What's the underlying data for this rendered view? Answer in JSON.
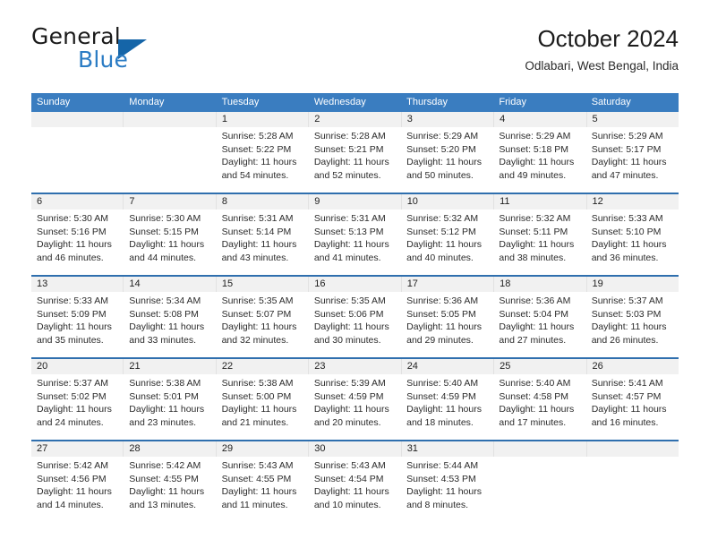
{
  "logo": {
    "word_top": "General",
    "word_bottom": "Blue",
    "triangle_color": "#1565a8",
    "blue_text_color": "#2b7cc4"
  },
  "header": {
    "title": "October 2024",
    "subtitle": "Odlabari, West Bengal, India"
  },
  "theme": {
    "header_blue": "#3a7dc0",
    "rule_blue": "#2f6fae",
    "number_band": "#f1f1f1"
  },
  "weekdays": [
    "Sunday",
    "Monday",
    "Tuesday",
    "Wednesday",
    "Thursday",
    "Friday",
    "Saturday"
  ],
  "labels": {
    "sunrise_prefix": "Sunrise:",
    "sunset_prefix": "Sunset:",
    "daylight_prefix": "Daylight:"
  },
  "weeks": [
    {
      "days": [
        {
          "num": "",
          "sunrise": "",
          "sunset": "",
          "daylight": ""
        },
        {
          "num": "",
          "sunrise": "",
          "sunset": "",
          "daylight": ""
        },
        {
          "num": "1",
          "sunrise": "Sunrise: 5:28 AM",
          "sunset": "Sunset: 5:22 PM",
          "daylight": "Daylight: 11 hours and 54 minutes."
        },
        {
          "num": "2",
          "sunrise": "Sunrise: 5:28 AM",
          "sunset": "Sunset: 5:21 PM",
          "daylight": "Daylight: 11 hours and 52 minutes."
        },
        {
          "num": "3",
          "sunrise": "Sunrise: 5:29 AM",
          "sunset": "Sunset: 5:20 PM",
          "daylight": "Daylight: 11 hours and 50 minutes."
        },
        {
          "num": "4",
          "sunrise": "Sunrise: 5:29 AM",
          "sunset": "Sunset: 5:18 PM",
          "daylight": "Daylight: 11 hours and 49 minutes."
        },
        {
          "num": "5",
          "sunrise": "Sunrise: 5:29 AM",
          "sunset": "Sunset: 5:17 PM",
          "daylight": "Daylight: 11 hours and 47 minutes."
        }
      ]
    },
    {
      "days": [
        {
          "num": "6",
          "sunrise": "Sunrise: 5:30 AM",
          "sunset": "Sunset: 5:16 PM",
          "daylight": "Daylight: 11 hours and 46 minutes."
        },
        {
          "num": "7",
          "sunrise": "Sunrise: 5:30 AM",
          "sunset": "Sunset: 5:15 PM",
          "daylight": "Daylight: 11 hours and 44 minutes."
        },
        {
          "num": "8",
          "sunrise": "Sunrise: 5:31 AM",
          "sunset": "Sunset: 5:14 PM",
          "daylight": "Daylight: 11 hours and 43 minutes."
        },
        {
          "num": "9",
          "sunrise": "Sunrise: 5:31 AM",
          "sunset": "Sunset: 5:13 PM",
          "daylight": "Daylight: 11 hours and 41 minutes."
        },
        {
          "num": "10",
          "sunrise": "Sunrise: 5:32 AM",
          "sunset": "Sunset: 5:12 PM",
          "daylight": "Daylight: 11 hours and 40 minutes."
        },
        {
          "num": "11",
          "sunrise": "Sunrise: 5:32 AM",
          "sunset": "Sunset: 5:11 PM",
          "daylight": "Daylight: 11 hours and 38 minutes."
        },
        {
          "num": "12",
          "sunrise": "Sunrise: 5:33 AM",
          "sunset": "Sunset: 5:10 PM",
          "daylight": "Daylight: 11 hours and 36 minutes."
        }
      ]
    },
    {
      "days": [
        {
          "num": "13",
          "sunrise": "Sunrise: 5:33 AM",
          "sunset": "Sunset: 5:09 PM",
          "daylight": "Daylight: 11 hours and 35 minutes."
        },
        {
          "num": "14",
          "sunrise": "Sunrise: 5:34 AM",
          "sunset": "Sunset: 5:08 PM",
          "daylight": "Daylight: 11 hours and 33 minutes."
        },
        {
          "num": "15",
          "sunrise": "Sunrise: 5:35 AM",
          "sunset": "Sunset: 5:07 PM",
          "daylight": "Daylight: 11 hours and 32 minutes."
        },
        {
          "num": "16",
          "sunrise": "Sunrise: 5:35 AM",
          "sunset": "Sunset: 5:06 PM",
          "daylight": "Daylight: 11 hours and 30 minutes."
        },
        {
          "num": "17",
          "sunrise": "Sunrise: 5:36 AM",
          "sunset": "Sunset: 5:05 PM",
          "daylight": "Daylight: 11 hours and 29 minutes."
        },
        {
          "num": "18",
          "sunrise": "Sunrise: 5:36 AM",
          "sunset": "Sunset: 5:04 PM",
          "daylight": "Daylight: 11 hours and 27 minutes."
        },
        {
          "num": "19",
          "sunrise": "Sunrise: 5:37 AM",
          "sunset": "Sunset: 5:03 PM",
          "daylight": "Daylight: 11 hours and 26 minutes."
        }
      ]
    },
    {
      "days": [
        {
          "num": "20",
          "sunrise": "Sunrise: 5:37 AM",
          "sunset": "Sunset: 5:02 PM",
          "daylight": "Daylight: 11 hours and 24 minutes."
        },
        {
          "num": "21",
          "sunrise": "Sunrise: 5:38 AM",
          "sunset": "Sunset: 5:01 PM",
          "daylight": "Daylight: 11 hours and 23 minutes."
        },
        {
          "num": "22",
          "sunrise": "Sunrise: 5:38 AM",
          "sunset": "Sunset: 5:00 PM",
          "daylight": "Daylight: 11 hours and 21 minutes."
        },
        {
          "num": "23",
          "sunrise": "Sunrise: 5:39 AM",
          "sunset": "Sunset: 4:59 PM",
          "daylight": "Daylight: 11 hours and 20 minutes."
        },
        {
          "num": "24",
          "sunrise": "Sunrise: 5:40 AM",
          "sunset": "Sunset: 4:59 PM",
          "daylight": "Daylight: 11 hours and 18 minutes."
        },
        {
          "num": "25",
          "sunrise": "Sunrise: 5:40 AM",
          "sunset": "Sunset: 4:58 PM",
          "daylight": "Daylight: 11 hours and 17 minutes."
        },
        {
          "num": "26",
          "sunrise": "Sunrise: 5:41 AM",
          "sunset": "Sunset: 4:57 PM",
          "daylight": "Daylight: 11 hours and 16 minutes."
        }
      ]
    },
    {
      "days": [
        {
          "num": "27",
          "sunrise": "Sunrise: 5:42 AM",
          "sunset": "Sunset: 4:56 PM",
          "daylight": "Daylight: 11 hours and 14 minutes."
        },
        {
          "num": "28",
          "sunrise": "Sunrise: 5:42 AM",
          "sunset": "Sunset: 4:55 PM",
          "daylight": "Daylight: 11 hours and 13 minutes."
        },
        {
          "num": "29",
          "sunrise": "Sunrise: 5:43 AM",
          "sunset": "Sunset: 4:55 PM",
          "daylight": "Daylight: 11 hours and 11 minutes."
        },
        {
          "num": "30",
          "sunrise": "Sunrise: 5:43 AM",
          "sunset": "Sunset: 4:54 PM",
          "daylight": "Daylight: 11 hours and 10 minutes."
        },
        {
          "num": "31",
          "sunrise": "Sunrise: 5:44 AM",
          "sunset": "Sunset: 4:53 PM",
          "daylight": "Daylight: 11 hours and 8 minutes."
        },
        {
          "num": "",
          "sunrise": "",
          "sunset": "",
          "daylight": ""
        },
        {
          "num": "",
          "sunrise": "",
          "sunset": "",
          "daylight": ""
        }
      ]
    }
  ]
}
